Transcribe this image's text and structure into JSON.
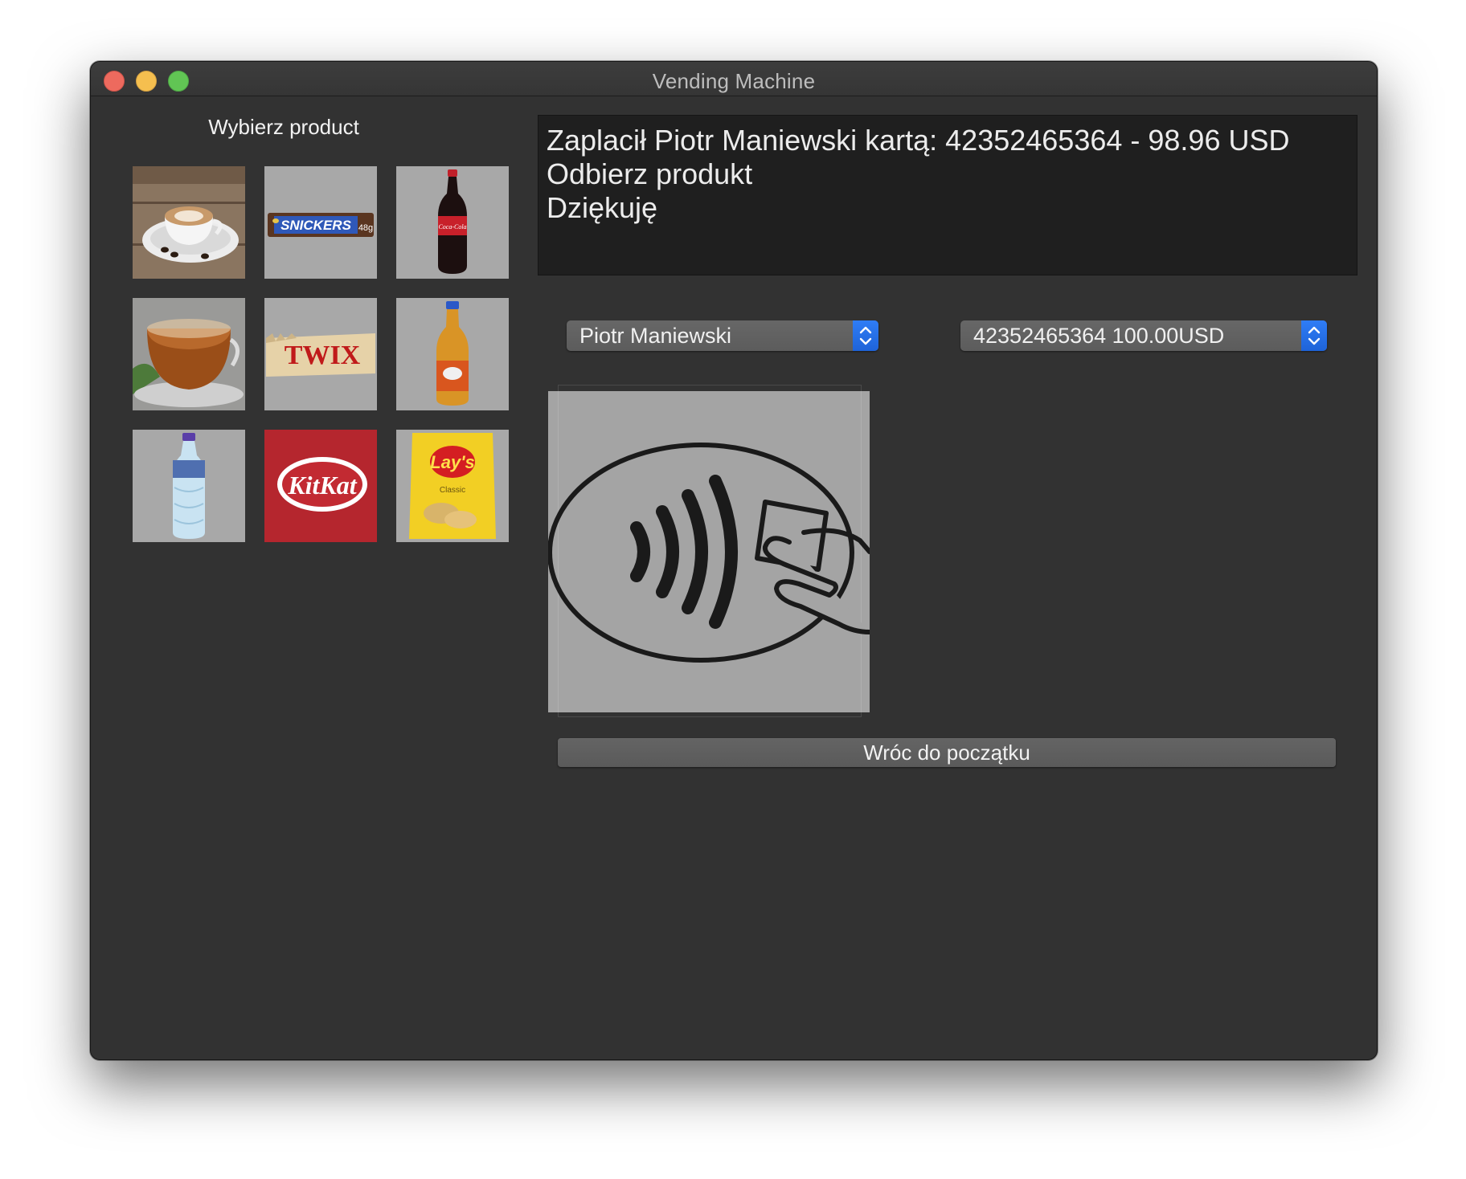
{
  "window": {
    "title": "Vending Machine"
  },
  "products": {
    "heading": "Wybierz product",
    "items": [
      {
        "name": "coffee"
      },
      {
        "name": "snickers",
        "label": "SNICKERS",
        "weight": "48g"
      },
      {
        "name": "coca-cola",
        "label": "Coca-Cola"
      },
      {
        "name": "tea"
      },
      {
        "name": "twix",
        "label": "TWIX"
      },
      {
        "name": "juice-bottle"
      },
      {
        "name": "water-bottle"
      },
      {
        "name": "kitkat",
        "label": "KitKat"
      },
      {
        "name": "lays",
        "label": "Lay's",
        "sublabel": "Classic"
      }
    ]
  },
  "message": {
    "lines": [
      "Zaplacił Piotr Maniewski kartą: 42352465364 - 98.96 USD",
      "Odbierz produkt",
      "Dziękuję"
    ]
  },
  "payment": {
    "customer_select": {
      "value": "Piotr Maniewski"
    },
    "card_select": {
      "value": "42352465364 100.00USD"
    }
  },
  "contactless": {
    "icon": "contactless-payment-icon"
  },
  "actions": {
    "back_label": "Wróc do początku"
  },
  "colors": {
    "window_bg": "#323232",
    "message_bg": "#1f1f1f",
    "accent": "#2f7df6",
    "tile_bg": "#a8a8a8"
  }
}
